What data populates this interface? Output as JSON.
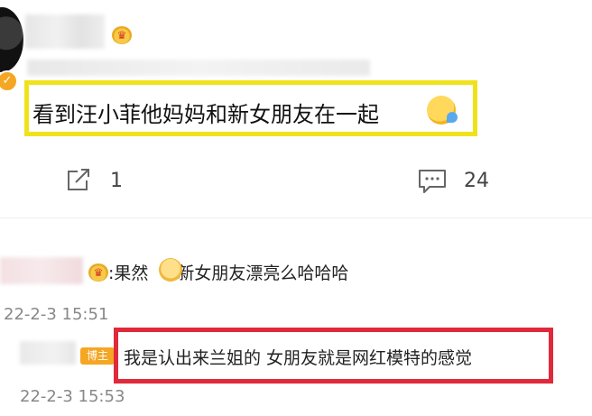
{
  "post": {
    "text": "看到汪小菲他妈妈和新女朋友在一起",
    "share_count": "1",
    "comment_count": "24"
  },
  "comments": [
    {
      "text_before_emoji": ":果然",
      "text_after_emoji": "新女朋友漂亮么哈哈哈",
      "time": "22-2-3 15:51"
    },
    {
      "badge": "博主",
      "text": "我是认出来兰姐的 女朋友就是网红模特的感觉",
      "time": "22-2-3 15:53"
    }
  ],
  "icons": {
    "share": "share-icon",
    "comment": "comment-icon",
    "crown": "crown-icon",
    "verified": "verified-icon"
  },
  "colors": {
    "highlight_yellow": "#f0e21a",
    "highlight_red": "#e0293a",
    "badge_orange": "#f5a623"
  }
}
